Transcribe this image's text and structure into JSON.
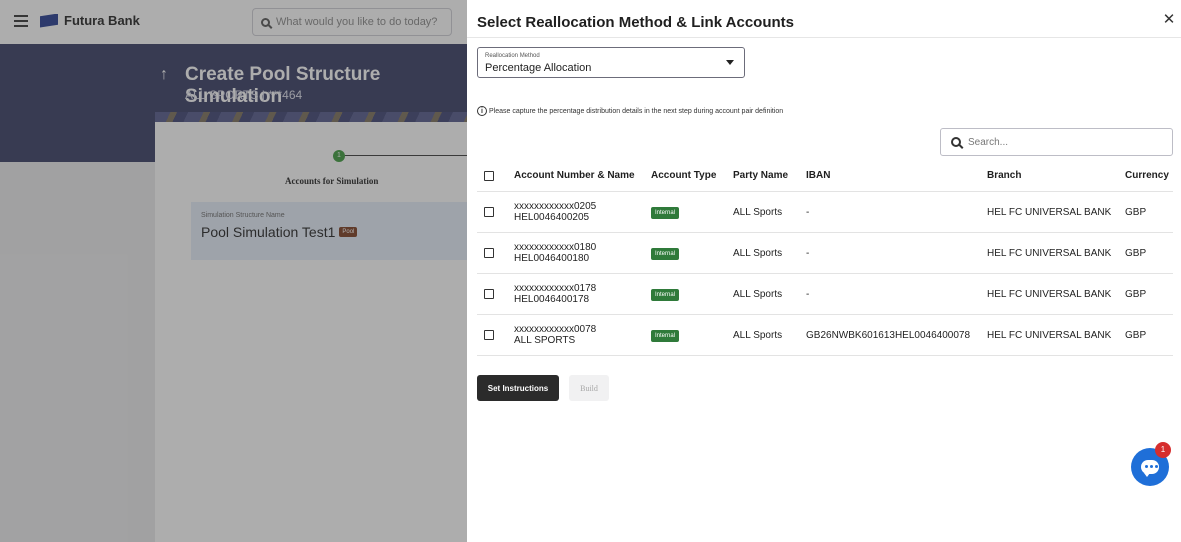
{
  "app": {
    "brand": "Futura Bank",
    "search_placeholder": "What would you like to do today?",
    "page_title": "Create Pool Structure Simulation",
    "page_subtitle": "ALL SPORTS | ***464",
    "step_number": "1",
    "step_label": "Accounts for Simulation",
    "sim_label": "Simulation Structure Name",
    "sim_name": "Pool Simulation Test1",
    "pool_badge": "Pool"
  },
  "drawer": {
    "title": "Select Reallocation Method & Link Accounts",
    "method_label": "Reallocation Method",
    "method_value": "Percentage Allocation",
    "info_text": "Please capture the percentage distribution details in the next step during account pair definition",
    "search_placeholder": "Search...",
    "columns": {
      "account": "Account Number & Name",
      "type": "Account Type",
      "party": "Party Name",
      "iban": "IBAN",
      "branch": "Branch",
      "currency": "Currency"
    },
    "rows": [
      {
        "number": "xxxxxxxxxxxx0205",
        "name": "HEL0046400205",
        "type": "Internal",
        "party": "ALL Sports",
        "iban": "-",
        "branch": "HEL FC UNIVERSAL BANK",
        "currency": "GBP"
      },
      {
        "number": "xxxxxxxxxxxx0180",
        "name": "HEL0046400180",
        "type": "Internal",
        "party": "ALL Sports",
        "iban": "-",
        "branch": "HEL FC UNIVERSAL BANK",
        "currency": "GBP"
      },
      {
        "number": "xxxxxxxxxxxx0178",
        "name": "HEL0046400178",
        "type": "Internal",
        "party": "ALL Sports",
        "iban": "-",
        "branch": "HEL FC UNIVERSAL BANK",
        "currency": "GBP"
      },
      {
        "number": "xxxxxxxxxxxx0078",
        "name": "ALL SPORTS",
        "type": "Internal",
        "party": "ALL Sports",
        "iban": "GB26NWBK601613HEL0046400078",
        "branch": "HEL FC UNIVERSAL BANK",
        "currency": "GBP"
      }
    ],
    "set_instructions_label": "Set Instructions",
    "build_label": "Build",
    "chat_count": "1"
  },
  "colors": {
    "banner": "#363b63",
    "internal_badge": "#2f7a3a",
    "primary_button": "#2b2b2b",
    "chat": "#1f6fd8"
  }
}
